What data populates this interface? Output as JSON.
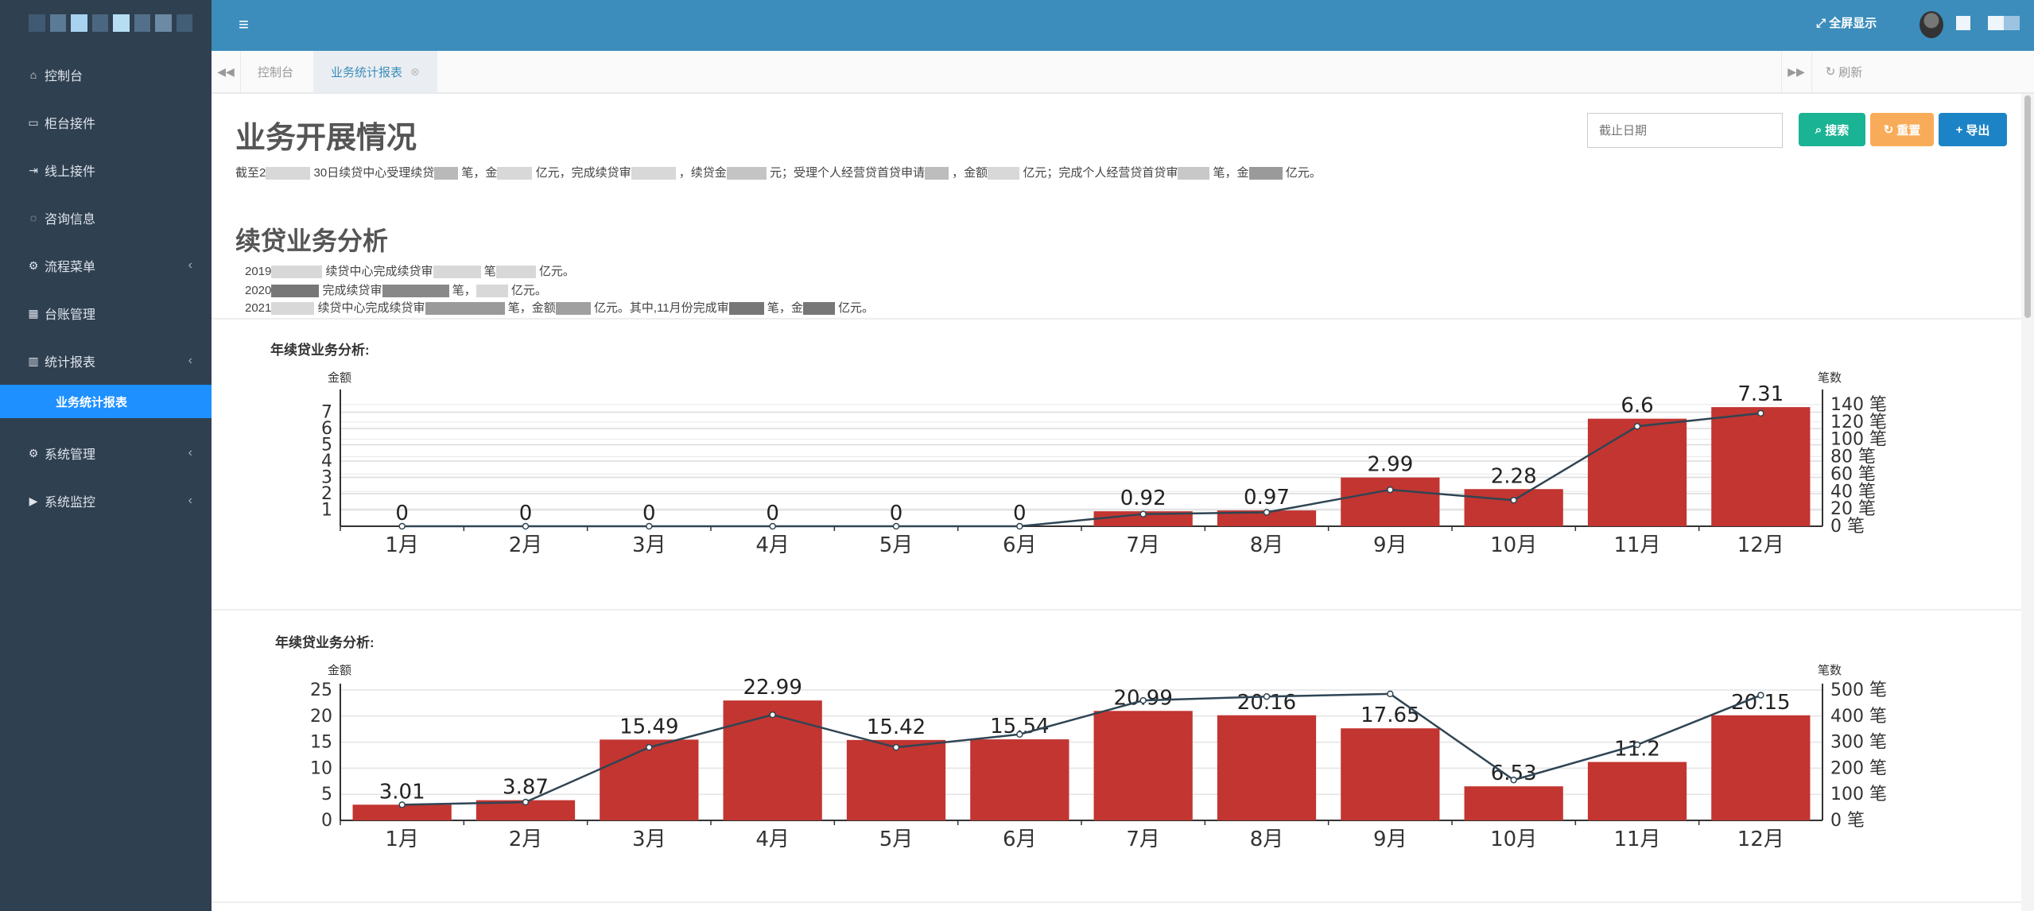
{
  "header": {
    "fullscreen_label": "全屏显示"
  },
  "sidebar": {
    "items": [
      {
        "label": "控制台",
        "icon": "home-icon"
      },
      {
        "label": "柜台接件",
        "icon": "desktop-icon"
      },
      {
        "label": "线上接件",
        "icon": "sign-in-icon"
      },
      {
        "label": "咨询信息",
        "icon": "comment-icon"
      },
      {
        "label": "流程菜单",
        "icon": "cogs-icon"
      },
      {
        "label": "台账管理",
        "icon": "calendar-icon"
      },
      {
        "label": "统计报表",
        "icon": "bar-chart-icon"
      },
      {
        "label": "业务统计报表",
        "icon": ""
      },
      {
        "label": "系统管理",
        "icon": "gear-icon"
      },
      {
        "label": "系统监控",
        "icon": "video-icon"
      }
    ]
  },
  "tabs": {
    "items": [
      "控制台",
      "业务统计报表"
    ],
    "refresh_label": "刷新"
  },
  "main": {
    "title": "业务开展情况",
    "summary": {
      "p1": "截至2",
      "p2": "30日续贷中心受理续贷",
      "p3": "笔，金",
      "p4": "亿元，完成续贷审",
      "p5": "，续贷金",
      "p6": "元；受理个人经营贷首贷申请",
      "p7": "，金额",
      "p8": "亿元；完成个人经营贷首贷审",
      "p9": "笔，金",
      "p10": "亿元。"
    },
    "date_placeholder": "截止日期",
    "buttons": {
      "search": "搜索",
      "reset": "重置",
      "export": "导出"
    },
    "section_title": "续贷业务分析",
    "lines": {
      "l1a": "2019",
      "l1b": "续贷中心完成续贷审",
      "l1c": "笔",
      "l1d": "亿元。",
      "l2a": "2020",
      "l2b": "完成续贷审",
      "l2c": "笔，",
      "l2d": "亿元。",
      "l3a": "2021",
      "l3b": "续贷中心完成续贷审",
      "l3c": "笔，金额",
      "l3d": "亿元。其中,11月份完成审",
      "l3e": "笔，金",
      "l3f": "亿元。"
    }
  },
  "chart_data": [
    {
      "type": "bar",
      "title": "年续贷业务分析:",
      "left_axis_label": "金额",
      "right_axis_label": "笔数",
      "categories": [
        "1月",
        "2月",
        "3月",
        "4月",
        "5月",
        "6月",
        "7月",
        "8月",
        "9月",
        "10月",
        "11月",
        "12月"
      ],
      "series": [
        {
          "type": "bar",
          "axis": "left",
          "values": [
            0,
            0,
            0,
            0,
            0,
            0,
            0.92,
            0.97,
            2.99,
            2.28,
            6.6,
            7.31
          ]
        },
        {
          "type": "line",
          "axis": "right",
          "values": [
            0,
            0,
            0,
            0,
            0,
            0,
            14,
            16,
            42,
            30,
            115,
            130
          ]
        }
      ],
      "ylim_left": [
        0,
        8
      ],
      "left_ticks": [
        "1",
        "2",
        "3",
        "4",
        "5",
        "6",
        "7"
      ],
      "ylim_right": [
        0,
        150
      ],
      "right_ticks": [
        "0 笔",
        "20 笔",
        "40 笔",
        "60 笔",
        "80 笔",
        "100 笔",
        "120 笔",
        "140 笔"
      ],
      "bar_color": "#c23531",
      "line_color": "#2f4554"
    },
    {
      "type": "bar",
      "title": "年续贷业务分析:",
      "left_axis_label": "金额",
      "right_axis_label": "笔数",
      "categories": [
        "1月",
        "2月",
        "3月",
        "4月",
        "5月",
        "6月",
        "7月",
        "8月",
        "9月",
        "10月",
        "11月",
        "12月"
      ],
      "series": [
        {
          "type": "bar",
          "axis": "left",
          "values": [
            3.01,
            3.87,
            15.49,
            22.99,
            15.42,
            15.54,
            20.99,
            20.16,
            17.65,
            6.53,
            11.2,
            20.15
          ]
        },
        {
          "type": "line",
          "axis": "right",
          "values": [
            60,
            70,
            280,
            405,
            280,
            330,
            460,
            475,
            485,
            155,
            290,
            480
          ]
        }
      ],
      "ylim_left": [
        0,
        25
      ],
      "left_ticks": [
        "0",
        "5",
        "10",
        "15",
        "20",
        "25"
      ],
      "ylim_right": [
        0,
        500
      ],
      "right_ticks": [
        "0 笔",
        "100 笔",
        "200 笔",
        "300 笔",
        "400 笔",
        "500 笔"
      ],
      "bar_color": "#c23531",
      "line_color": "#2f4554"
    }
  ]
}
